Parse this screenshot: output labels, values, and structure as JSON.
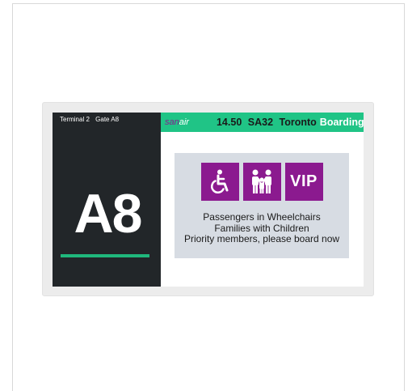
{
  "display": {
    "terminal_label": "Terminal 2",
    "gate_label": "Gate A8",
    "gate_code": "A8",
    "accent_color": "#1fb87c"
  },
  "header": {
    "brand_san": "san",
    "brand_air": "air",
    "time": "14.50",
    "flight_number": "SA32",
    "destination": "Toronto",
    "status": "Boarding",
    "bar_color": "#20c486"
  },
  "boarding_info": {
    "icons": [
      "wheelchair-icon",
      "family-icon",
      "vip-badge"
    ],
    "vip_label": "VIP",
    "tile_color": "#8b1a8f",
    "lines": [
      "Passengers in Wheelchairs",
      "Families with Children",
      "Priority members, please board now"
    ]
  }
}
